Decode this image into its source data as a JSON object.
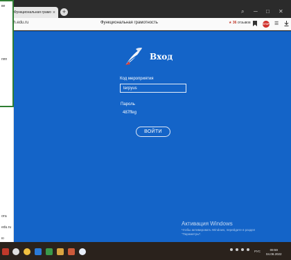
{
  "browser": {
    "tab_title": "Функциональная грамотность",
    "tab_close": "×",
    "new_tab": "+",
    "window_controls": [
      "⌕",
      "─",
      "□",
      "✕"
    ],
    "url": "g.resh.edu.ru",
    "page_title": "Функциональная грамотность",
    "reviews_count": "★ 36",
    "reviews_label": "отзывов",
    "stop_label": "STOP",
    "bookmark_icon": "bookmark-icon",
    "menu_icon": "☰"
  },
  "left_panel": {
    "top_text": "ве",
    "mid_text": "ппп",
    "bottom_text_1": "ота",
    "bottom_text_2": "edu.ru",
    "bottom_text_3": "ю"
  },
  "login": {
    "heading": "Вход",
    "event_code_label": "Код мероприятия",
    "event_code_value": "terpyus",
    "password_label": "Пароль",
    "password_value": "487ffeg",
    "submit_label": "ВОЙТИ"
  },
  "activation": {
    "title": "Активация Windows",
    "subtitle": "Чтобы активировать Windows, перейдите в раздел \"Параметры\"."
  },
  "taskbar": {
    "clock_time": "09:59",
    "clock_date": "04.08.2022",
    "lang": "РУС"
  }
}
